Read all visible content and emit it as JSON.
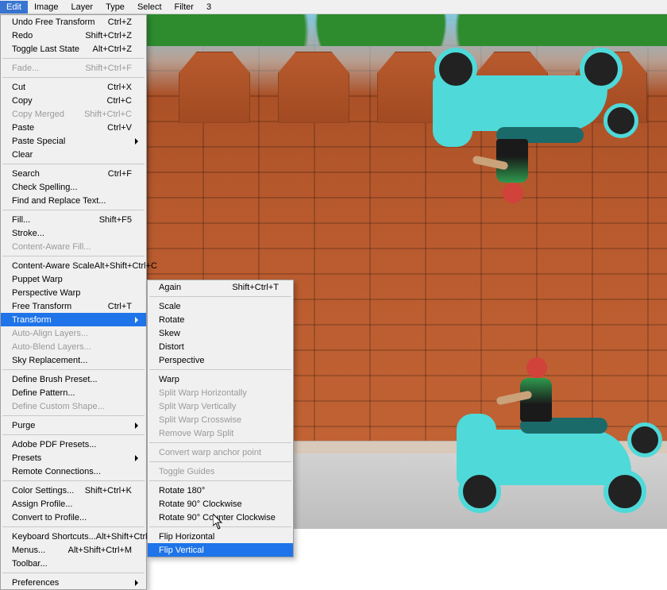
{
  "menubar": {
    "items": [
      "Edit",
      "Image",
      "Layer",
      "Type",
      "Select",
      "Filter",
      "3"
    ],
    "open_index": 0
  },
  "edit_menu": {
    "groups": [
      [
        {
          "label": "Undo Free Transform",
          "shortcut": "Ctrl+Z",
          "enabled": true
        },
        {
          "label": "Redo",
          "shortcut": "Shift+Ctrl+Z",
          "enabled": true
        },
        {
          "label": "Toggle Last State",
          "shortcut": "Alt+Ctrl+Z",
          "enabled": true
        }
      ],
      [
        {
          "label": "Fade...",
          "shortcut": "Shift+Ctrl+F",
          "enabled": false
        }
      ],
      [
        {
          "label": "Cut",
          "shortcut": "Ctrl+X",
          "enabled": true
        },
        {
          "label": "Copy",
          "shortcut": "Ctrl+C",
          "enabled": true
        },
        {
          "label": "Copy Merged",
          "shortcut": "Shift+Ctrl+C",
          "enabled": false
        },
        {
          "label": "Paste",
          "shortcut": "Ctrl+V",
          "enabled": true
        },
        {
          "label": "Paste Special",
          "shortcut": "",
          "enabled": true,
          "submenu": true
        },
        {
          "label": "Clear",
          "shortcut": "",
          "enabled": true
        }
      ],
      [
        {
          "label": "Search",
          "shortcut": "Ctrl+F",
          "enabled": true
        },
        {
          "label": "Check Spelling...",
          "shortcut": "",
          "enabled": true
        },
        {
          "label": "Find and Replace Text...",
          "shortcut": "",
          "enabled": true
        }
      ],
      [
        {
          "label": "Fill...",
          "shortcut": "Shift+F5",
          "enabled": true
        },
        {
          "label": "Stroke...",
          "shortcut": "",
          "enabled": true
        },
        {
          "label": "Content-Aware Fill...",
          "shortcut": "",
          "enabled": false
        }
      ],
      [
        {
          "label": "Content-Aware Scale",
          "shortcut": "Alt+Shift+Ctrl+C",
          "enabled": true
        },
        {
          "label": "Puppet Warp",
          "shortcut": "",
          "enabled": true
        },
        {
          "label": "Perspective Warp",
          "shortcut": "",
          "enabled": true
        },
        {
          "label": "Free Transform",
          "shortcut": "Ctrl+T",
          "enabled": true
        },
        {
          "label": "Transform",
          "shortcut": "",
          "enabled": true,
          "submenu": true,
          "highlight": true
        },
        {
          "label": "Auto-Align Layers...",
          "shortcut": "",
          "enabled": false
        },
        {
          "label": "Auto-Blend Layers...",
          "shortcut": "",
          "enabled": false
        },
        {
          "label": "Sky Replacement...",
          "shortcut": "",
          "enabled": true
        }
      ],
      [
        {
          "label": "Define Brush Preset...",
          "shortcut": "",
          "enabled": true
        },
        {
          "label": "Define Pattern...",
          "shortcut": "",
          "enabled": true
        },
        {
          "label": "Define Custom Shape...",
          "shortcut": "",
          "enabled": false
        }
      ],
      [
        {
          "label": "Purge",
          "shortcut": "",
          "enabled": true,
          "submenu": true
        }
      ],
      [
        {
          "label": "Adobe PDF Presets...",
          "shortcut": "",
          "enabled": true
        },
        {
          "label": "Presets",
          "shortcut": "",
          "enabled": true,
          "submenu": true
        },
        {
          "label": "Remote Connections...",
          "shortcut": "",
          "enabled": true
        }
      ],
      [
        {
          "label": "Color Settings...",
          "shortcut": "Shift+Ctrl+K",
          "enabled": true
        },
        {
          "label": "Assign Profile...",
          "shortcut": "",
          "enabled": true
        },
        {
          "label": "Convert to Profile...",
          "shortcut": "",
          "enabled": true
        }
      ],
      [
        {
          "label": "Keyboard Shortcuts...",
          "shortcut": "Alt+Shift+Ctrl+K",
          "enabled": true
        },
        {
          "label": "Menus...",
          "shortcut": "Alt+Shift+Ctrl+M",
          "enabled": true
        },
        {
          "label": "Toolbar...",
          "shortcut": "",
          "enabled": true
        }
      ],
      [
        {
          "label": "Preferences",
          "shortcut": "",
          "enabled": true,
          "submenu": true
        }
      ]
    ]
  },
  "transform_submenu": {
    "groups": [
      [
        {
          "label": "Again",
          "shortcut": "Shift+Ctrl+T",
          "enabled": true
        }
      ],
      [
        {
          "label": "Scale",
          "shortcut": "",
          "enabled": true
        },
        {
          "label": "Rotate",
          "shortcut": "",
          "enabled": true
        },
        {
          "label": "Skew",
          "shortcut": "",
          "enabled": true
        },
        {
          "label": "Distort",
          "shortcut": "",
          "enabled": true
        },
        {
          "label": "Perspective",
          "shortcut": "",
          "enabled": true
        }
      ],
      [
        {
          "label": "Warp",
          "shortcut": "",
          "enabled": true
        },
        {
          "label": "Split Warp Horizontally",
          "shortcut": "",
          "enabled": false
        },
        {
          "label": "Split Warp Vertically",
          "shortcut": "",
          "enabled": false
        },
        {
          "label": "Split Warp Crosswise",
          "shortcut": "",
          "enabled": false
        },
        {
          "label": "Remove Warp Split",
          "shortcut": "",
          "enabled": false
        }
      ],
      [
        {
          "label": "Convert warp anchor point",
          "shortcut": "",
          "enabled": false
        }
      ],
      [
        {
          "label": "Toggle Guides",
          "shortcut": "",
          "enabled": false
        }
      ],
      [
        {
          "label": "Rotate 180°",
          "shortcut": "",
          "enabled": true
        },
        {
          "label": "Rotate 90° Clockwise",
          "shortcut": "",
          "enabled": true
        },
        {
          "label": "Rotate 90° Counter Clockwise",
          "shortcut": "",
          "enabled": true
        }
      ],
      [
        {
          "label": "Flip Horizontal",
          "shortcut": "",
          "enabled": true
        },
        {
          "label": "Flip Vertical",
          "shortcut": "",
          "enabled": true,
          "highlight": true
        }
      ]
    ]
  }
}
